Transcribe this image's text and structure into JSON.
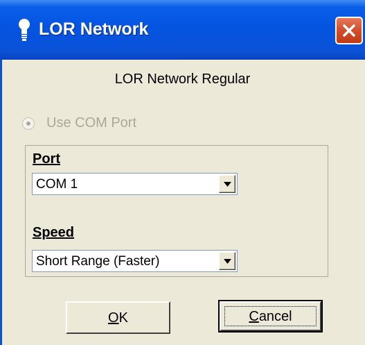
{
  "window": {
    "title": "LOR Network",
    "icon": "lightbulb-icon",
    "close_icon": "close-icon"
  },
  "dialog": {
    "heading": "LOR Network Regular",
    "radio_label": "Use COM Port",
    "port": {
      "label": "Port",
      "value": "COM 1"
    },
    "speed": {
      "label": "Speed",
      "value": "Short Range (Faster)"
    },
    "ok_button": {
      "mnemonic": "O",
      "rest": "K"
    },
    "cancel_button": {
      "mnemonic": "C",
      "rest": "ancel"
    }
  },
  "colors": {
    "titlebar": "#0554e1",
    "close_button": "#d4502e",
    "dialog_background": "#ece9d8",
    "disabled_text": "#aca899"
  }
}
